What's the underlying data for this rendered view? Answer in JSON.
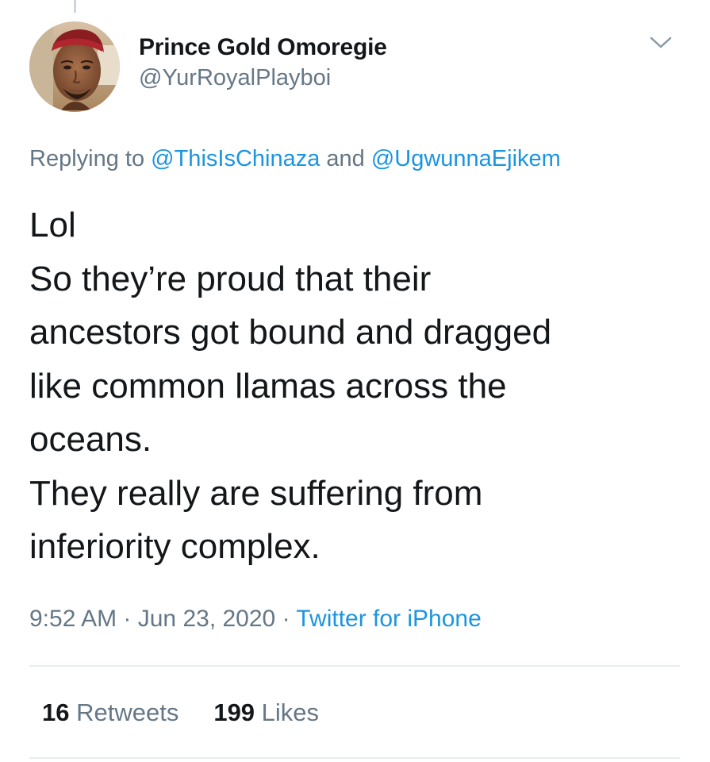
{
  "author": {
    "display_name": "Prince Gold Omoregie",
    "handle": "@YurRoyalPlayboi"
  },
  "reply": {
    "prefix": "Replying to ",
    "mention_1": "@ThisIsChinaza",
    "conjunction": " and ",
    "mention_2": "@UgwunnaEjikem"
  },
  "tweet": {
    "lines": [
      "Lol",
      "So they’re proud that their",
      "ancestors got bound and dragged",
      "like common llamas across the",
      "oceans.",
      "They really are suffering from",
      "inferiority complex."
    ]
  },
  "meta": {
    "time": "9:52 AM",
    "separator_1": " · ",
    "date": "Jun 23, 2020",
    "separator_2": " · ",
    "source": "Twitter for iPhone"
  },
  "stats": {
    "retweets_count": "16",
    "retweets_label": " Retweets",
    "likes_count": "199",
    "likes_label": " Likes"
  },
  "icons": {
    "menu": "chevron-down-icon",
    "avatar": "avatar-photo"
  },
  "colors": {
    "link": "#1b95e0",
    "secondary_text": "#657786",
    "primary_text": "#14171a",
    "divider": "#e6ecf0"
  }
}
